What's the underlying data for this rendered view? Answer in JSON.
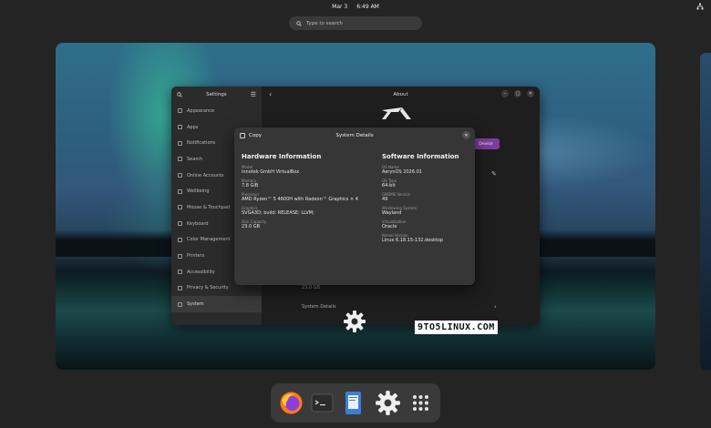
{
  "topbar": {
    "date": "Mar 3",
    "time": "6:49 AM"
  },
  "search": {
    "placeholder": "Type to search"
  },
  "settings": {
    "title": "Settings",
    "sidebar": [
      {
        "label": "Appearance"
      },
      {
        "label": "Apps"
      },
      {
        "label": "Notifications"
      },
      {
        "label": "Search"
      },
      {
        "label": "Online Accounts"
      },
      {
        "label": "Wellbeing"
      },
      {
        "label": "Mouse & Touchpad"
      },
      {
        "label": "Keyboard"
      },
      {
        "label": "Color Management"
      },
      {
        "label": "Printers"
      },
      {
        "label": "Accessibility"
      },
      {
        "label": "Privacy & Security"
      },
      {
        "label": "System"
      }
    ],
    "main_title": "About",
    "device_button": "Device",
    "disk_value": "23.0 GB",
    "system_details_label": "System Details"
  },
  "dialog": {
    "copy_label": "Copy",
    "title": "System Details",
    "hardware": {
      "heading": "Hardware Information",
      "fields": [
        {
          "label": "Model",
          "value": "innotek GmbH VirtualBox"
        },
        {
          "label": "Memory",
          "value": "7.8 GiB"
        },
        {
          "label": "Processor",
          "value": "AMD Ryzen™ 5 4600H with Radeon™ Graphics × 4"
        },
        {
          "label": "Graphics",
          "value": "SVGA3D; build: RELEASE; LLVM;"
        },
        {
          "label": "Disk Capacity",
          "value": "23.0 GB"
        }
      ]
    },
    "software": {
      "heading": "Software Information",
      "fields": [
        {
          "label": "OS Name",
          "value": "AerynOS 2026.01"
        },
        {
          "label": "OS Type",
          "value": "64-bit"
        },
        {
          "label": "GNOME Version",
          "value": "49"
        },
        {
          "label": "Windowing System",
          "value": "Wayland"
        },
        {
          "label": "Virtualization",
          "value": "Oracle"
        },
        {
          "label": "Kernel Version",
          "value": "Linux 6.18.15-132.desktop"
        }
      ]
    }
  },
  "watermark": {
    "text": "9TO5LINUX.COM"
  },
  "dock": {
    "items": [
      "firefox-icon",
      "terminal-icon",
      "text-editor-icon",
      "settings-icon",
      "app-grid-icon"
    ]
  }
}
